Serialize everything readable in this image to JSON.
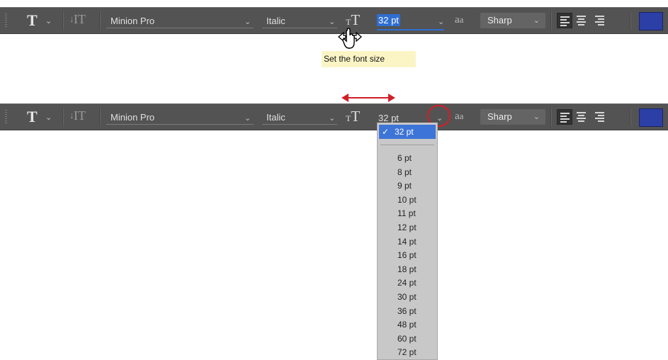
{
  "toolbar": {
    "tool_glyph": "T",
    "orientation_glyph": "IT",
    "font_family": "Minion Pro",
    "font_style": "Italic",
    "size_icon_small": "T",
    "size_icon_big": "T",
    "font_size": "32 pt",
    "antialias_icon": "a",
    "antialias_icon_sub": "a",
    "antialias": "Sharp",
    "chevron": "⌄",
    "color_swatch": "#2b3fa6"
  },
  "tooltip": {
    "text": "Set the font size"
  },
  "size_dropdown": {
    "selected": "32 pt",
    "check": "✓",
    "options": [
      "6 pt",
      "8 pt",
      "9 pt",
      "10 pt",
      "11 pt",
      "12 pt",
      "14 pt",
      "16 pt",
      "18 pt",
      "24 pt",
      "30 pt",
      "36 pt",
      "48 pt",
      "60 pt",
      "72 pt"
    ]
  },
  "colors": {
    "toolbar_bg": "#535353",
    "highlight": "#2f6ed2",
    "tooltip_bg": "#fbf5c6",
    "annotation_red": "#d21f28"
  },
  "icons": [
    "type-tool-icon",
    "text-orientation-icon",
    "font-size-icon",
    "anti-alias-icon",
    "align-left-icon",
    "align-center-icon",
    "align-right-icon",
    "scrubby-hand-cursor-icon",
    "double-arrow-icon",
    "highlight-circle"
  ]
}
